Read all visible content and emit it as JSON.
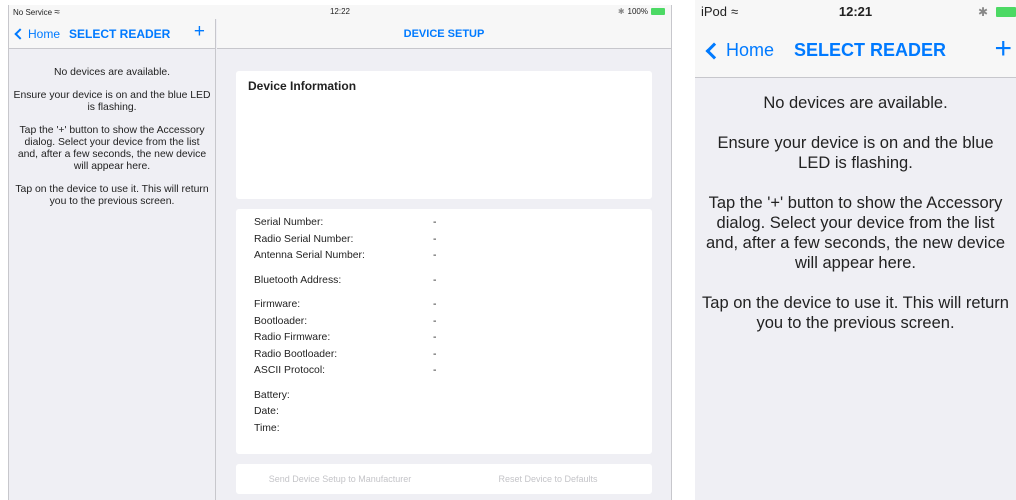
{
  "ipad": {
    "status": {
      "carrier": "No Service",
      "time": "12:22",
      "battery": "100%"
    },
    "master": {
      "back_label": "Home",
      "title": "SELECT READER",
      "add_label": "+",
      "messages": [
        "No devices are available.",
        "Ensure your device is on and the blue LED is flashing.",
        "Tap the '+' button to show the Accessory dialog. Select your device from the list and, after a few seconds, the new device will appear here.",
        "Tap on the device to use it. This will return you to the previous screen."
      ]
    },
    "detail": {
      "title": "DEVICE SETUP",
      "info_heading": "Device Information",
      "fields": [
        {
          "label": "Serial Number:",
          "value": "-"
        },
        {
          "label": "Radio Serial Number:",
          "value": "-"
        },
        {
          "label": "Antenna Serial Number:",
          "value": "-"
        },
        {
          "label": "Bluetooth Address:",
          "value": "-"
        },
        {
          "label": "Firmware:",
          "value": "-"
        },
        {
          "label": "Bootloader:",
          "value": "-"
        },
        {
          "label": "Radio Firmware:",
          "value": "-"
        },
        {
          "label": "Radio Bootloader:",
          "value": "-"
        },
        {
          "label": "ASCII Protocol:",
          "value": "-"
        },
        {
          "label": "Battery:",
          "value": ""
        },
        {
          "label": "Date:",
          "value": ""
        },
        {
          "label": "Time:",
          "value": ""
        }
      ],
      "buttons": {
        "send": "Send Device Setup to Manufacturer",
        "reset": "Reset Device to Defaults"
      }
    }
  },
  "ipod": {
    "status": {
      "carrier": "iPod",
      "time": "12:21"
    },
    "back_label": "Home",
    "title": "SELECT READER",
    "add_label": "+",
    "messages": [
      "No devices are available.",
      "Ensure your device is on and the blue LED is flashing.",
      "Tap the '+' button to show the Accessory dialog. Select your device from the list and, after a few seconds, the new device will appear here.",
      "Tap on the device to use it. This will return you to the previous screen."
    ]
  },
  "colors": {
    "accent": "#007aff",
    "battery": "#4cd964",
    "background": "#efeff4"
  }
}
